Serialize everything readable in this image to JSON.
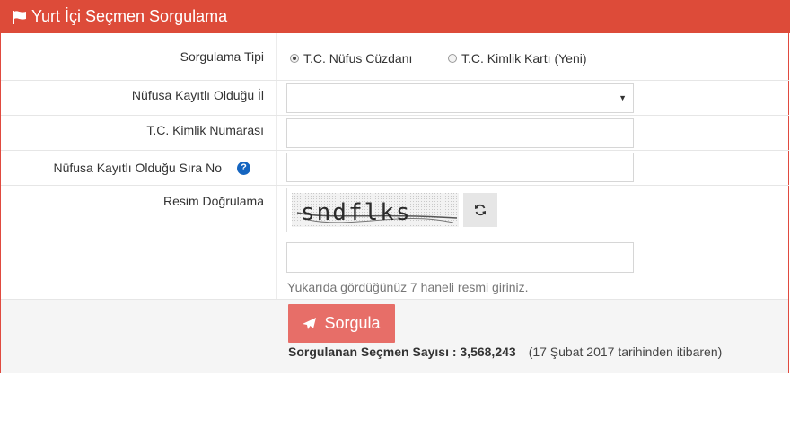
{
  "header": {
    "title": "Yurt İçi Seçmen Sorgulama",
    "icon": "flag-icon"
  },
  "form": {
    "query_type": {
      "label": "Sorgulama Tipi",
      "options": [
        {
          "label": "T.C. Nüfus Cüzdanı",
          "checked": true
        },
        {
          "label": "T.C. Kimlik Kartı (Yeni)",
          "checked": false
        }
      ]
    },
    "province": {
      "label": "Nüfusa Kayıtlı Olduğu İl",
      "value": ""
    },
    "tc_number": {
      "label": "T.C. Kimlik Numarası",
      "value": ""
    },
    "sequence_no": {
      "label": "Nüfusa Kayıtlı Olduğu Sıra No",
      "help_icon": "?",
      "value": ""
    },
    "captcha": {
      "label": "Resim Doğrulama",
      "image_text": "sndflks",
      "input_value": "",
      "hint": "Yukarıda gördüğünüz 7 haneli resmi giriniz."
    }
  },
  "submit": {
    "label": "Sorgula",
    "icon": "send-icon"
  },
  "stats": {
    "label": "Sorgulanan Seçmen Sayısı : 3,568,243",
    "since": "(17 Şubat 2017 tarihinden itibaren)"
  },
  "colors": {
    "header": "#dd4b39",
    "button": "#e76e68",
    "help": "#1565c0"
  }
}
